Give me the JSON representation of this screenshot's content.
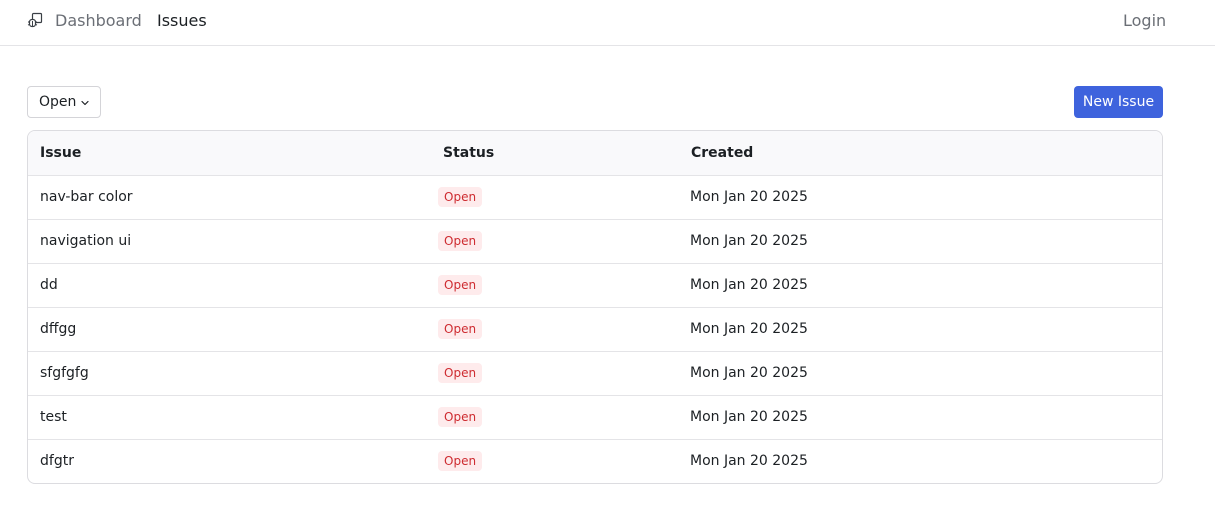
{
  "navbar": {
    "logo_icon": "bug-icon",
    "links": [
      {
        "label": "Dashboard"
      },
      {
        "label": "Issues"
      }
    ],
    "login_label": "Login"
  },
  "toolbar": {
    "status_filter_value": "Open",
    "new_issue_label": "New Issue"
  },
  "table": {
    "headers": {
      "issue": "Issue",
      "status": "Status",
      "created": "Created"
    },
    "rows": [
      {
        "title": "nav-bar color",
        "status": "Open",
        "created": "Mon Jan 20 2025"
      },
      {
        "title": "navigation ui",
        "status": "Open",
        "created": "Mon Jan 20 2025"
      },
      {
        "title": "dd",
        "status": "Open",
        "created": "Mon Jan 20 2025"
      },
      {
        "title": "dffgg",
        "status": "Open",
        "created": "Mon Jan 20 2025"
      },
      {
        "title": "sfgfgfg",
        "status": "Open",
        "created": "Mon Jan 20 2025"
      },
      {
        "title": "test",
        "status": "Open",
        "created": "Mon Jan 20 2025"
      },
      {
        "title": "dfgtr",
        "status": "Open",
        "created": "Mon Jan 20 2025"
      }
    ]
  },
  "colors": {
    "accent": "#3e63dd",
    "badge_bg": "#feebec",
    "badge_text": "#ce2c31"
  }
}
